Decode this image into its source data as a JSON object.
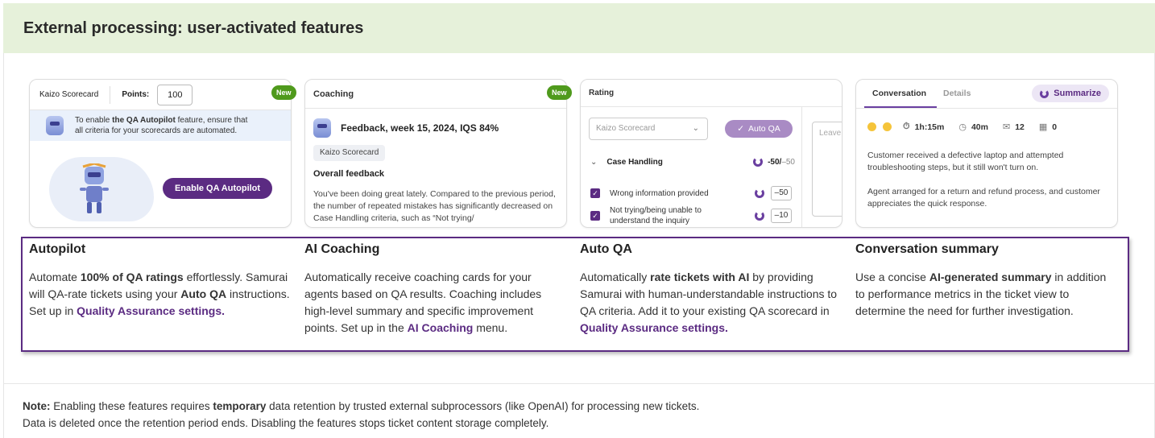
{
  "header": {
    "title": "External processing: user-activated features"
  },
  "colors": {
    "accent": "#5b2b82",
    "new_badge": "#4f9a1c",
    "header_bg": "#e6f1da"
  },
  "autopilot_card": {
    "scorecard_label": "Kaizo Scorecard",
    "points_label": "Points:",
    "points_value": "100",
    "new_badge": "New",
    "info_prefix": "To enable ",
    "info_bold": "the QA Autopilot",
    "info_suffix": " feature, ensure that",
    "info_line2": "all criteria for your scorecards are automated.",
    "enable_button": "Enable QA Autopilot"
  },
  "coaching_card": {
    "title": "Coaching",
    "new_badge": "New",
    "feedback_title": "Feedback, week 15, 2024, IQS 84%",
    "scorecard_tag": "Kaizo Scorecard",
    "overall_label": "Overall feedback",
    "body": "You've been doing great lately. Compared to the previous period, the number of repeated mistakes has significantly decreased on Case Handling criteria, such as “Not trying/"
  },
  "rating_card": {
    "title": "Rating",
    "scorecard_placeholder": "Kaizo Scorecard",
    "auto_qa_button": "Auto QA",
    "comment_placeholder": "Leave",
    "section_label": "Case Handling",
    "section_score": "-50/",
    "section_max": "–50",
    "rows": [
      {
        "label": "Wrong information provided",
        "score": "–50"
      },
      {
        "label": "Not trying/being unable to understand the inquiry",
        "score": "–10"
      }
    ]
  },
  "conversation_card": {
    "tab_conversation": "Conversation",
    "tab_details": "Details",
    "summarize_button": "Summarize",
    "metrics": {
      "duration": "1h:15m",
      "time": "40m",
      "messages": "12",
      "inbox": "0"
    },
    "summary_p1": "Customer received a defective laptop and attempted troubleshooting steps, but it still won't turn on.",
    "summary_p2": "Agent arranged for a return and refund process, and customer appreciates the quick response."
  },
  "features": {
    "autopilot": {
      "title": "Autopilot",
      "t1": "Automate ",
      "b1": "100% of QA ratings",
      "t2": " effortlessly. Samurai will QA-rate tickets using your ",
      "b2": "Auto QA",
      "t3": " instructions. Set up in ",
      "link": "Quality Assurance settings."
    },
    "ai_coaching": {
      "title": "AI Coaching",
      "t1": "Automatically receive coaching cards for your agents based on QA results. Coaching includes high-level summary and specific improvement points. Set up in the ",
      "link": "AI Coaching",
      "t2": " menu."
    },
    "auto_qa": {
      "title": "Auto QA",
      "t1": "Automatically ",
      "b1": "rate tickets with AI",
      "t2": " by providing Samurai with human-understandable instructions to QA criteria. Add it to your existing QA scorecard in ",
      "link": "Quality Assurance settings."
    },
    "conversation_summary": {
      "title": "Conversation summary",
      "t1": "Use a concise ",
      "b1": "AI-generated summary",
      "t2": " in addition to performance metrics in the ticket view to determine the need for further investigation."
    }
  },
  "note": {
    "label": "Note:",
    "t1": " Enabling these features requires ",
    "b1": "temporary",
    "t2": " data retention by trusted external subprocessors (like OpenAI) for processing new tickets.",
    "line2": "Data is deleted once the retention period ends. Disabling the features stops ticket content storage completely."
  }
}
